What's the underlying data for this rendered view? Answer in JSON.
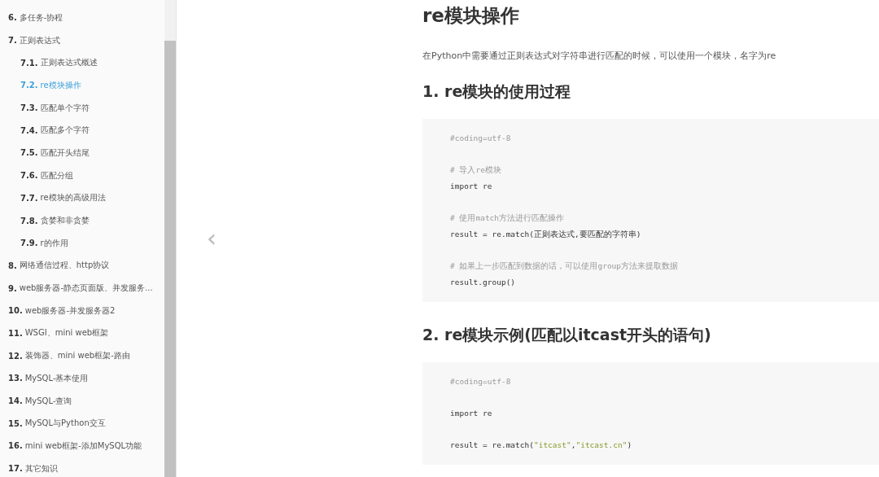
{
  "sidebar": {
    "items": [
      {
        "number": "6.",
        "label": "多任务-协程",
        "selected": false
      },
      {
        "number": "7.",
        "label": "正则表达式",
        "selected": false,
        "children": [
          {
            "number": "7.1.",
            "label": "正则表达式概述",
            "selected": false
          },
          {
            "number": "7.2.",
            "label": "re模块操作",
            "selected": true
          },
          {
            "number": "7.3.",
            "label": "匹配单个字符",
            "selected": false
          },
          {
            "number": "7.4.",
            "label": "匹配多个字符",
            "selected": false
          },
          {
            "number": "7.5.",
            "label": "匹配开头结尾",
            "selected": false
          },
          {
            "number": "7.6.",
            "label": "匹配分组",
            "selected": false
          },
          {
            "number": "7.7.",
            "label": "re模块的高级用法",
            "selected": false
          },
          {
            "number": "7.8.",
            "label": "贪婪和非贪婪",
            "selected": false
          },
          {
            "number": "7.9.",
            "label": "r的作用",
            "selected": false
          }
        ]
      },
      {
        "number": "8.",
        "label": "网络通信过程、http协议",
        "selected": false
      },
      {
        "number": "9.",
        "label": "web服务器-静态页面版、并发服务...",
        "selected": false
      },
      {
        "number": "10.",
        "label": "web服务器-并发服务器2",
        "selected": false
      },
      {
        "number": "11.",
        "label": "WSGI、mini web框架",
        "selected": false
      },
      {
        "number": "12.",
        "label": "装饰器、mini web框架-路由",
        "selected": false
      },
      {
        "number": "13.",
        "label": "MySQL-基本使用",
        "selected": false
      },
      {
        "number": "14.",
        "label": "MySQL-查询",
        "selected": false
      },
      {
        "number": "15.",
        "label": "MySQL与Python交互",
        "selected": false
      },
      {
        "number": "16.",
        "label": "mini web框架-添加MySQL功能",
        "selected": false
      },
      {
        "number": "17.",
        "label": "其它知识",
        "selected": false
      }
    ]
  },
  "prev_button": {
    "label": "‹"
  },
  "article": {
    "title": "re模块操作",
    "intro": "在Python中需要通过正则表达式对字符串进行匹配的时候，可以使用一个模块，名字为re",
    "sections": [
      {
        "heading": "1. re模块的使用过程",
        "code": [
          {
            "kind": "text",
            "parts": [
              {
                "kind": "comment",
                "text": "#coding=utf-8"
              }
            ]
          },
          {
            "kind": "blank"
          },
          {
            "kind": "text",
            "parts": [
              {
                "kind": "comment",
                "text": "# 导入re模块"
              }
            ]
          },
          {
            "kind": "text",
            "parts": [
              {
                "kind": "code",
                "text": "import re"
              }
            ]
          },
          {
            "kind": "blank"
          },
          {
            "kind": "text",
            "parts": [
              {
                "kind": "comment",
                "text": "# 使用match方法进行匹配操作"
              }
            ]
          },
          {
            "kind": "text",
            "parts": [
              {
                "kind": "code",
                "text": "result = re.match(正则表达式,要匹配的字符串)"
              }
            ]
          },
          {
            "kind": "blank"
          },
          {
            "kind": "text",
            "parts": [
              {
                "kind": "comment",
                "text": "# 如果上一步匹配到数据的话，可以使用group方法来提取数据"
              }
            ]
          },
          {
            "kind": "text",
            "parts": [
              {
                "kind": "code",
                "text": "result.group()"
              }
            ]
          }
        ]
      },
      {
        "heading": "2. re模块示例(匹配以itcast开头的语句)",
        "code": [
          {
            "kind": "text",
            "parts": [
              {
                "kind": "comment",
                "text": "#coding=utf-8"
              }
            ]
          },
          {
            "kind": "blank"
          },
          {
            "kind": "text",
            "parts": [
              {
                "kind": "code",
                "text": "import re"
              }
            ]
          },
          {
            "kind": "blank"
          },
          {
            "kind": "text",
            "parts": [
              {
                "kind": "code",
                "text": "result = re.match("
              },
              {
                "kind": "string",
                "text": "\"itcast\""
              },
              {
                "kind": "code",
                "text": ","
              },
              {
                "kind": "string",
                "text": "\"itcast.cn\""
              },
              {
                "kind": "code",
                "text": ")"
              }
            ]
          }
        ]
      }
    ]
  }
}
